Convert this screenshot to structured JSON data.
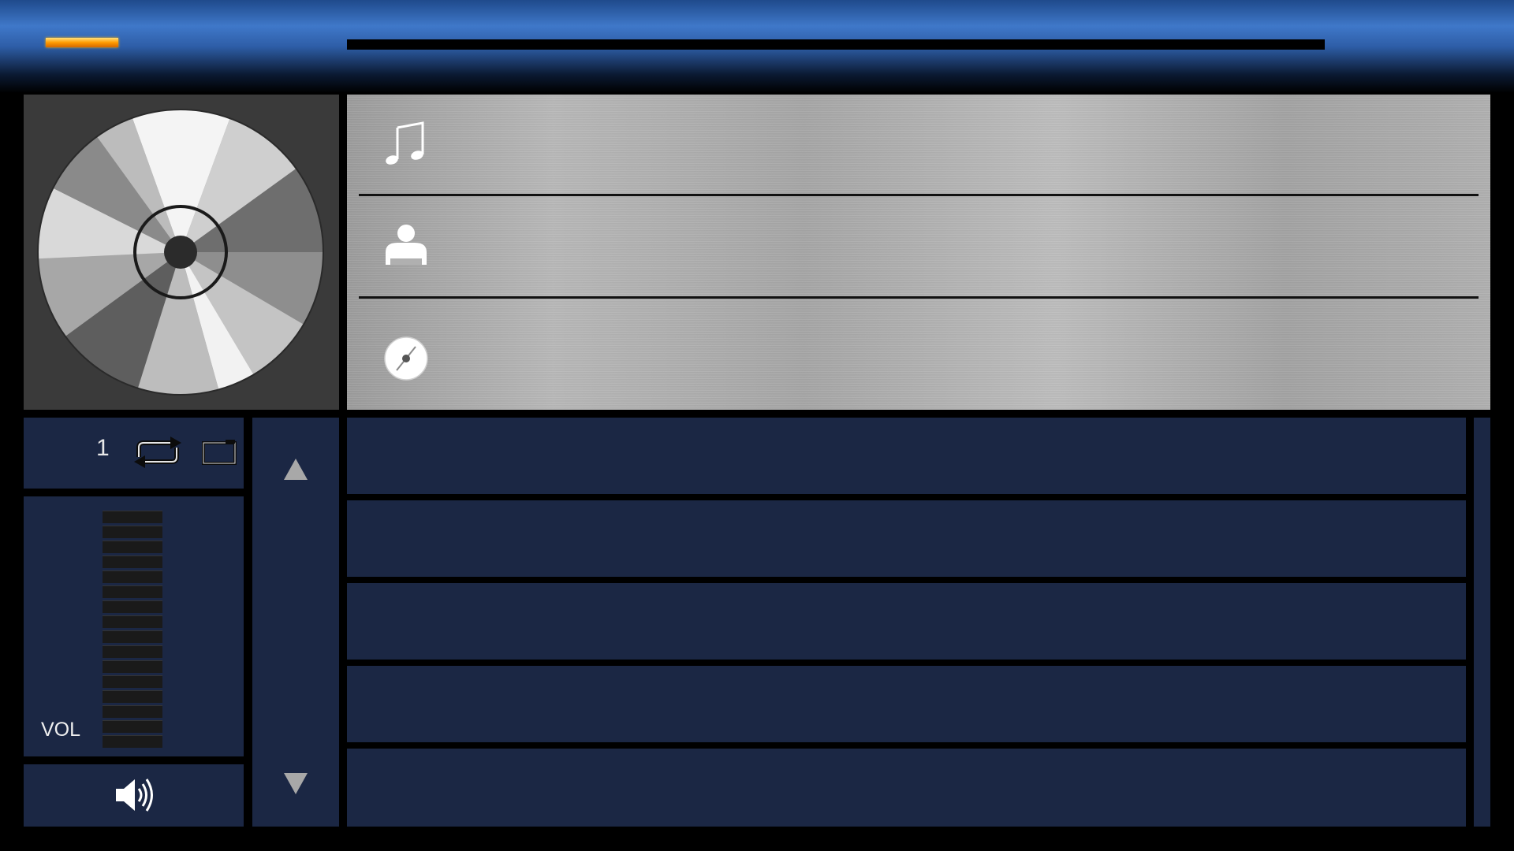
{
  "player": {
    "progress_percent": 0,
    "now_playing": {
      "title": "",
      "artist": "",
      "album": ""
    },
    "icons": {
      "title": "music-note-icon",
      "artist": "person-icon",
      "album": "disc-icon"
    }
  },
  "controls": {
    "repeat_count": "1",
    "volume_label": "VOL",
    "volume_level_percent": 0,
    "volume_segments": 16
  },
  "playlist": {
    "tracks": [
      "",
      "",
      "",
      "",
      ""
    ]
  },
  "colors": {
    "panel": "#1b2744",
    "accent": "#e08a00",
    "background": "#000000"
  }
}
